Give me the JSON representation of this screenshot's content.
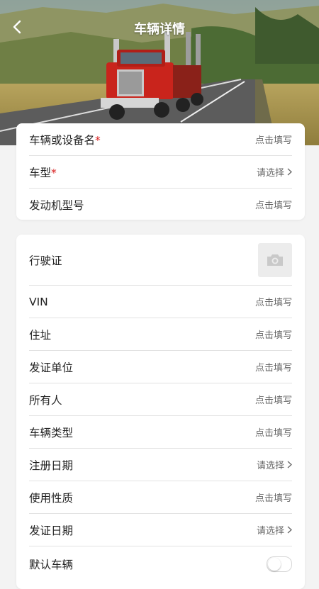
{
  "header": {
    "title": "车辆详情"
  },
  "placeholders": {
    "fill": "点击填写",
    "select": "请选择"
  },
  "basic": {
    "vehicle_name_label": "车辆或设备名",
    "vehicle_model_label": "车型",
    "engine_model_label": "发动机型号",
    "required_mark": "*"
  },
  "license": {
    "driving_license_label": "行驶证",
    "vin_label": "VIN",
    "address_label": "住址",
    "issuing_authority_label": "发证单位",
    "owner_label": "所有人",
    "vehicle_type_label": "车辆类型",
    "register_date_label": "注册日期",
    "use_nature_label": "使用性质",
    "issue_date_label": "发证日期",
    "default_vehicle_label": "默认车辆"
  },
  "colors": {
    "accent_required": "#d81e1e",
    "background": "#f3f3f3"
  }
}
